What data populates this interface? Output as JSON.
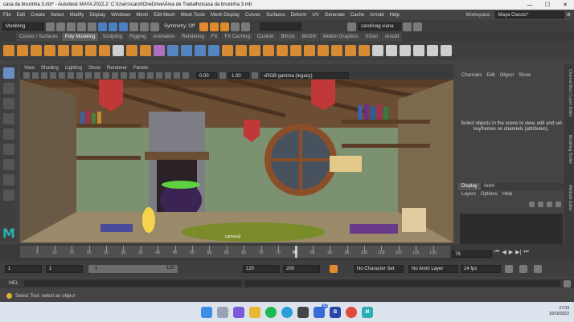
{
  "window": {
    "title": "casa da bruxinha 3.mb* - Autodesk MAYA 2022.2: C:\\Users\\carol\\OneDrive\\Área de Trabalho\\casa da bruxinha 3.mb",
    "minimize": "—",
    "maximize": "☐",
    "close": "✕"
  },
  "menubar": {
    "items": [
      "File",
      "Edit",
      "Create",
      "Select",
      "Modify",
      "Display",
      "Windows",
      "Mesh",
      "Edit Mesh",
      "Mesh Tools",
      "Mesh Display",
      "Curves",
      "Surfaces",
      "Deform",
      "UV",
      "Generate",
      "Cache",
      "Arnold",
      "Help"
    ],
    "workspace_label": "Workspace :",
    "workspace_value": "Maya Classic*"
  },
  "statusline": {
    "menuset": "Modeling",
    "symmetry": "Symmetry: Off",
    "user": "carolinag.viana"
  },
  "shelf": {
    "tabs": [
      "Curves / Surfaces",
      "Poly Modeling",
      "Sculpting",
      "Rigging",
      "Animation",
      "Rendering",
      "FX",
      "FX Caching",
      "Custom",
      "Bifrost",
      "MASH",
      "Motion Graphics",
      "XGen",
      "Arnold"
    ],
    "active_tab": "Poly Modeling"
  },
  "viewport": {
    "menu": [
      "View",
      "Shading",
      "Lighting",
      "Show",
      "Renderer",
      "Panels"
    ],
    "field_a": "0.00",
    "field_b": "1.00",
    "colorspace": "sRGB gamma (legacy)",
    "camera_label": "camera3"
  },
  "channelbox": {
    "menu": [
      "Channels",
      "Edit",
      "Object",
      "Show"
    ],
    "message": "Select objects in the scene to view, edit and set keyframes on channels (attributes).",
    "tabs": [
      "Display",
      "Anim"
    ],
    "active_tab": "Display",
    "sub_menu": [
      "Layers",
      "Options",
      "Help"
    ]
  },
  "side_tabs": [
    "Channel Box / Layer Editor",
    "Modeling Toolkit",
    "Attribute Editor"
  ],
  "timeslider": {
    "ticks": [
      "5",
      "10",
      "15",
      "20",
      "25",
      "30",
      "35",
      "40",
      "45",
      "50",
      "55",
      "60",
      "65",
      "70",
      "75",
      "80",
      "85",
      "90",
      "95",
      "100",
      "105",
      "110",
      "115",
      "120"
    ],
    "current_frame": "78",
    "current_label": "78",
    "current_fraction": 0.64
  },
  "range": {
    "start": "1",
    "start_inner": "1",
    "slider_start": "1",
    "slider_end": "120",
    "end_inner": "120",
    "end": "200",
    "character_set": "No Character Set",
    "anim_layer": "No Anim Layer",
    "fps": "24 fps"
  },
  "mel": {
    "label": "MEL"
  },
  "helpline": {
    "text": "Select Tool: select an object"
  },
  "taskbar": {
    "time": "17:03",
    "date": "10/10/2022",
    "badge": "63"
  }
}
